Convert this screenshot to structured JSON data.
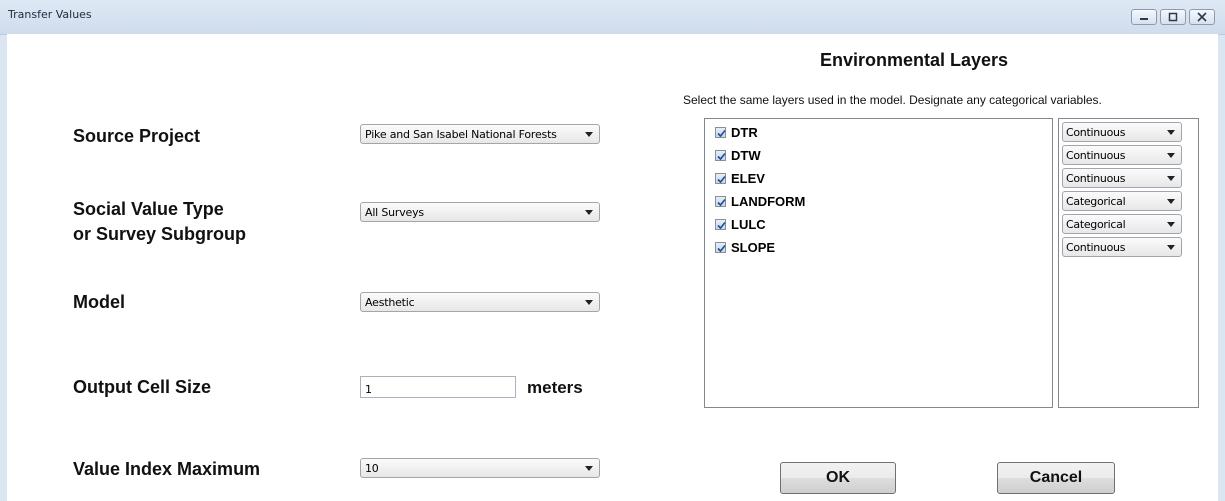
{
  "window": {
    "title": "Transfer Values",
    "controls": [
      "minimize-icon",
      "maximize-icon",
      "close-icon"
    ]
  },
  "form": {
    "source_project": {
      "label": "Source Project",
      "value": "Pike and San Isabel National Forests"
    },
    "social_value_type": {
      "label_line1": "Social Value Type",
      "label_line2": "or Survey Subgroup",
      "value": "All Surveys"
    },
    "model": {
      "label": "Model",
      "value": "Aesthetic"
    },
    "output_cell_size": {
      "label": "Output Cell Size",
      "value": "1",
      "unit": "meters"
    },
    "value_index_maximum": {
      "label": "Value Index Maximum",
      "value": "10"
    }
  },
  "env_layers": {
    "title": "Environmental Layers",
    "instructions": "Select the same layers used in the model.  Designate any categorical variables.",
    "layers": [
      {
        "name": "DTR",
        "checked": true,
        "type": "Continuous"
      },
      {
        "name": "DTW",
        "checked": true,
        "type": "Continuous"
      },
      {
        "name": "ELEV",
        "checked": true,
        "type": "Continuous"
      },
      {
        "name": "LANDFORM",
        "checked": true,
        "type": "Categorical"
      },
      {
        "name": "LULC",
        "checked": true,
        "type": "Categorical"
      },
      {
        "name": "SLOPE",
        "checked": true,
        "type": "Continuous"
      }
    ]
  },
  "buttons": {
    "ok": "OK",
    "cancel": "Cancel"
  }
}
